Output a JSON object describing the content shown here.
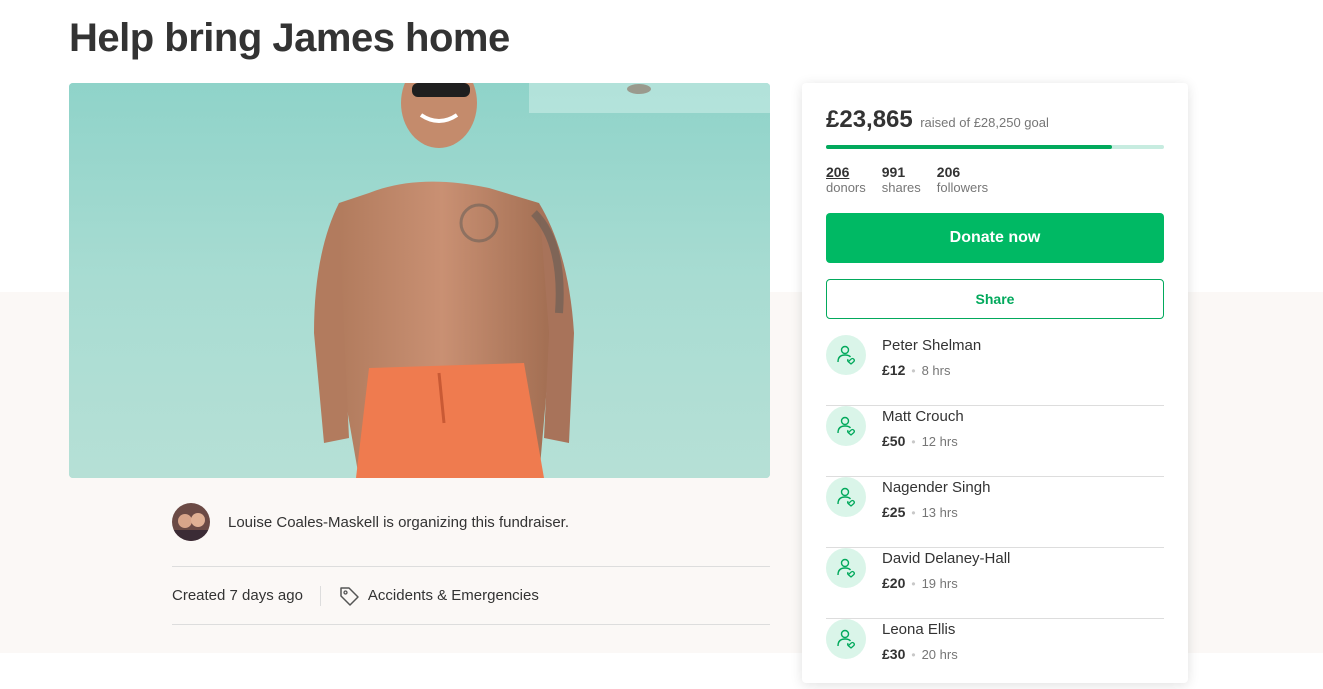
{
  "page": {
    "title": "Help bring James home"
  },
  "organizer": {
    "text": "Louise Coales-Maskell is organizing this fundraiser."
  },
  "meta": {
    "created": "Created 7 days ago",
    "category": "Accidents & Emergencies"
  },
  "donation_panel": {
    "raised_amount": "£23,865",
    "goal_text": "raised of £28,250 goal",
    "progress_fraction": 0.845,
    "stats": [
      {
        "value": "206",
        "label": "donors"
      },
      {
        "value": "991",
        "label": "shares"
      },
      {
        "value": "206",
        "label": "followers"
      }
    ],
    "donate_label": "Donate now",
    "share_label": "Share",
    "donations": [
      {
        "name": "Peter Shelman",
        "amount": "£12",
        "time": "8 hrs"
      },
      {
        "name": "Matt Crouch",
        "amount": "£50",
        "time": "12 hrs"
      },
      {
        "name": "Nagender Singh",
        "amount": "£25",
        "time": "13 hrs"
      },
      {
        "name": "David Delaney-Hall",
        "amount": "£20",
        "time": "19 hrs"
      },
      {
        "name": "Leona Ellis",
        "amount": "£30",
        "time": "20 hrs"
      }
    ]
  },
  "colors": {
    "primary_green": "#00b964",
    "progress_track": "#c7ece0",
    "band_background": "#fbf8f6"
  },
  "icons": {
    "donor": "donor-heart-icon",
    "category": "tag-icon"
  }
}
